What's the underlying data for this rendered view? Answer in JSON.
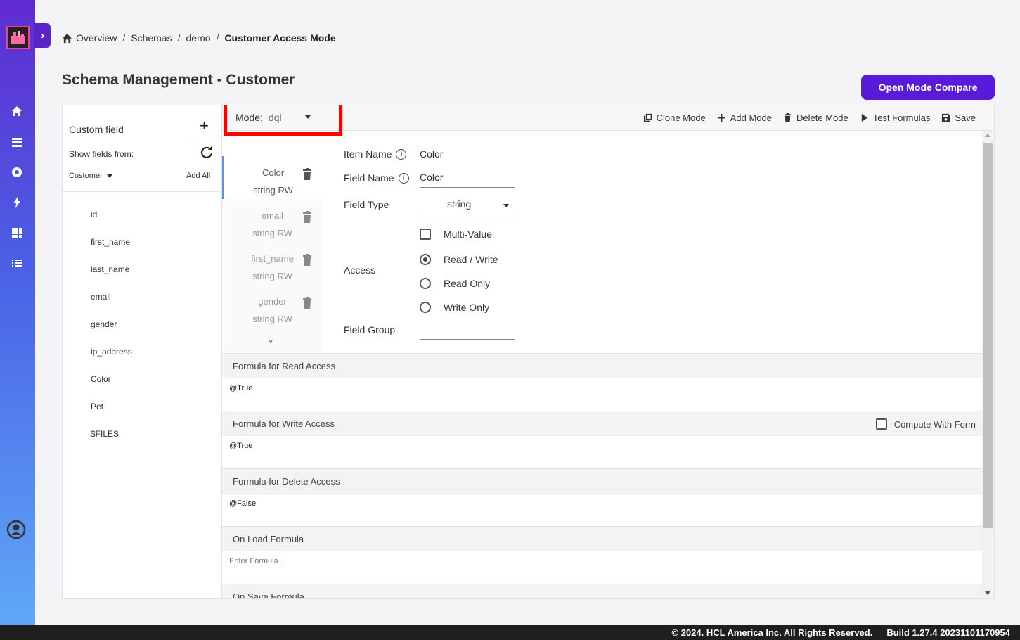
{
  "breadcrumb": {
    "items": [
      "Overview",
      "Schemas",
      "demo"
    ],
    "current": "Customer Access Mode"
  },
  "page": {
    "title": "Schema Management - Customer",
    "compare_button": "Open Mode Compare"
  },
  "left_panel": {
    "custom_field_label": "Custom field",
    "show_fields_from": "Show fields from:",
    "source": "Customer",
    "add_all": "Add All",
    "fields": [
      "id",
      "first_name",
      "last_name",
      "email",
      "gender",
      "ip_address",
      "Color",
      "Pet",
      "$FILES"
    ]
  },
  "toolbar": {
    "mode_label": "Mode:",
    "mode_value": "dql",
    "actions": [
      "Clone Mode",
      "Add Mode",
      "Delete Mode",
      "Test Formulas",
      "Save"
    ]
  },
  "item_list": [
    {
      "name": "Color",
      "meta": "string RW",
      "active": true
    },
    {
      "name": "email",
      "meta": "string RW",
      "active": false
    },
    {
      "name": "first_name",
      "meta": "string RW",
      "active": false
    },
    {
      "name": "gender",
      "meta": "string RW",
      "active": false
    }
  ],
  "form": {
    "item_name_label": "Item Name",
    "item_name_value": "Color",
    "field_name_label": "Field Name",
    "field_name_value": "Color",
    "field_type_label": "Field Type",
    "field_type_value": "string",
    "multi_value_label": "Multi-Value",
    "access_label": "Access",
    "access_options": [
      "Read / Write",
      "Read Only",
      "Write Only"
    ],
    "access_selected": "Read / Write",
    "field_group_label": "Field Group",
    "field_group_value": ""
  },
  "formulas": [
    {
      "title": "Formula for Read Access",
      "value": "@True"
    },
    {
      "title": "Formula for Write Access",
      "value": "@True",
      "extra": "Compute With Form"
    },
    {
      "title": "Formula for Delete Access",
      "value": "@False"
    },
    {
      "title": "On Load Formula",
      "placeholder": "Enter Formula..."
    },
    {
      "title": "On Save Formula"
    }
  ],
  "footer": {
    "copyright": "© 2024. HCL America Inc. All Rights Reserved.",
    "build": "Build 1.27.4 20231101170954"
  },
  "colors": {
    "accent": "#5a1ad9",
    "highlight_box": "#ff0000",
    "sidebar_top": "#5f2bd0",
    "sidebar_bottom": "#5fa8f8"
  }
}
